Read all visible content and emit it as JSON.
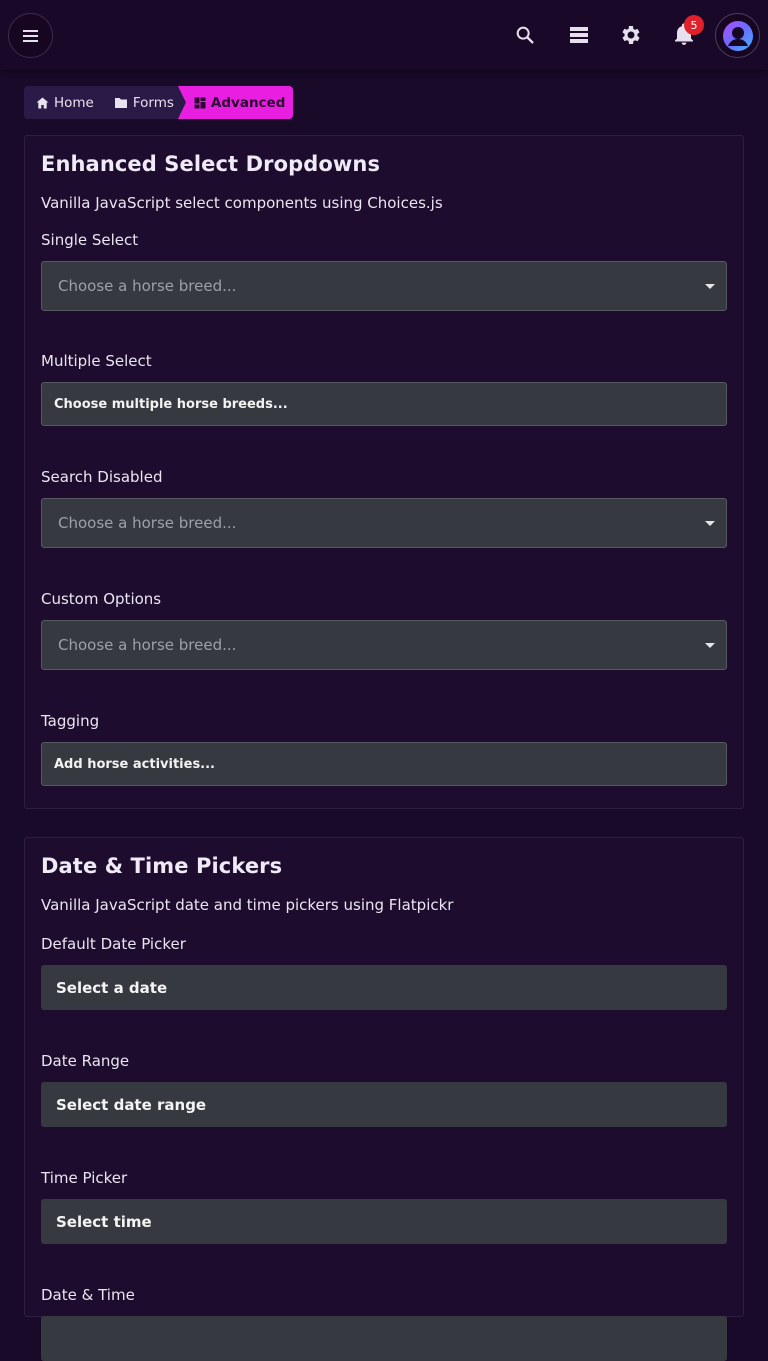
{
  "topbar": {
    "notification_count": "5",
    "icons": [
      "menu-icon",
      "search-icon",
      "stack-icon",
      "gear-icon",
      "bell-icon",
      "user-icon"
    ]
  },
  "breadcrumb": {
    "home": "Home",
    "forms": "Forms",
    "current": "Advanced"
  },
  "select_card": {
    "title": "Enhanced Select Dropdowns",
    "description": "Vanilla JavaScript select components using Choices.js",
    "single": {
      "label": "Single Select",
      "placeholder": "Choose a horse breed..."
    },
    "multiple": {
      "label": "Multiple Select",
      "placeholder": "Choose multiple horse breeds..."
    },
    "search_disabled": {
      "label": "Search Disabled",
      "placeholder": "Choose a horse breed..."
    },
    "custom": {
      "label": "Custom Options",
      "placeholder": "Choose a horse breed..."
    },
    "tagging": {
      "label": "Tagging",
      "placeholder": "Add horse activities..."
    }
  },
  "date_card": {
    "title": "Date & Time Pickers",
    "description": "Vanilla JavaScript date and time pickers using Flatpickr",
    "default_date": {
      "label": "Default Date Picker",
      "placeholder": "Select a date"
    },
    "date_range": {
      "label": "Date Range",
      "placeholder": "Select date range"
    },
    "time": {
      "label": "Time Picker",
      "placeholder": "Select time"
    },
    "date_time": {
      "label": "Date & Time",
      "placeholder": ""
    }
  },
  "colors": {
    "background": "#1a0a2a",
    "accent": "#e81fe0",
    "badge": "#e0202a",
    "input": "#36393f"
  }
}
